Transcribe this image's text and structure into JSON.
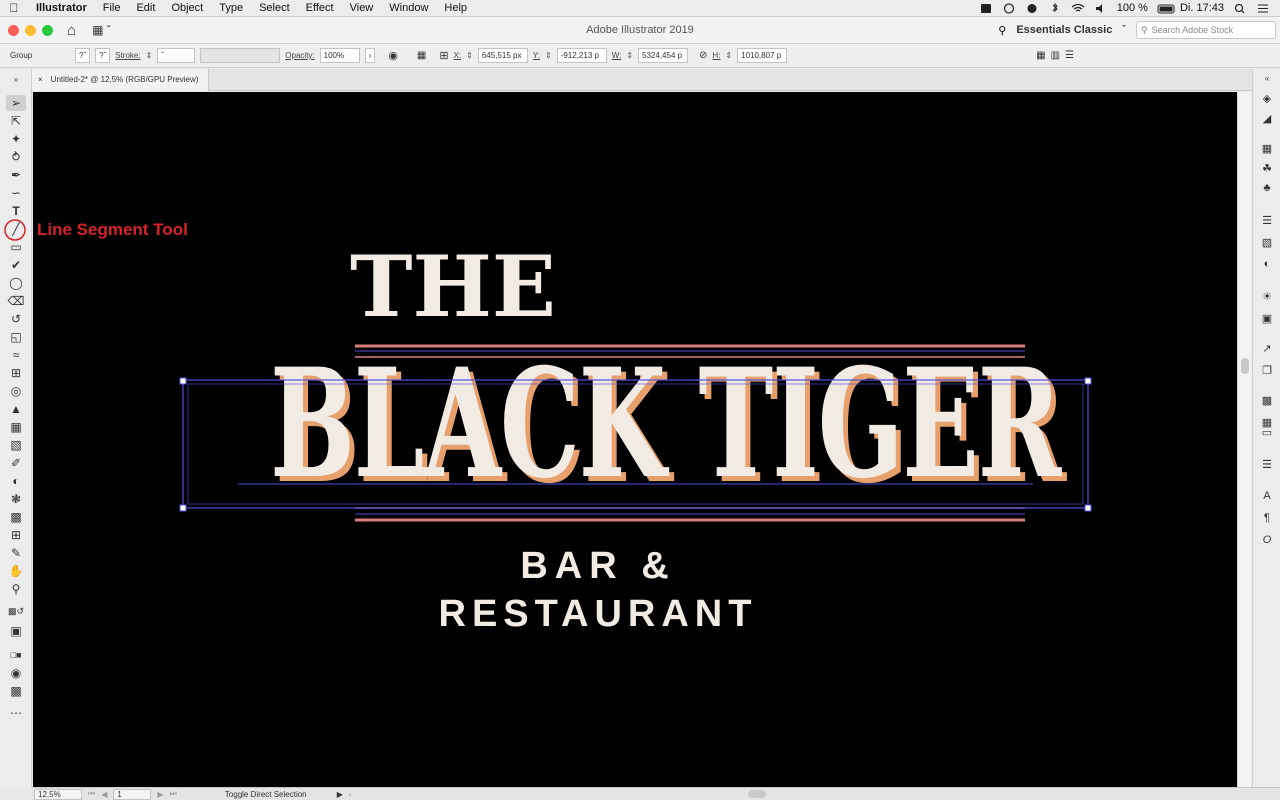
{
  "menubar": {
    "app_name": "Illustrator",
    "items": [
      "File",
      "Edit",
      "Object",
      "Type",
      "Select",
      "Effect",
      "View",
      "Window",
      "Help"
    ],
    "battery": "100 %",
    "clock": "Di. 17:43"
  },
  "titlebar": {
    "app_title": "Adobe Illustrator 2019",
    "workspace": "Essentials Classic",
    "search_placeholder": "Search Adobe Stock"
  },
  "controlbar": {
    "selection": "Group",
    "stroke_label": "Stroke:",
    "opacity_label": "Opacity:",
    "opacity_value": "100%",
    "x_label": "X:",
    "x_value": "645,515 px",
    "y_label": "Y:",
    "y_value": "-912,213 p",
    "w_label": "W:",
    "w_value": "5324,454 p",
    "h_label": "H:",
    "h_value": "1010,807 p"
  },
  "document": {
    "tab_title": "Untitled-2* @ 12,5% (RGB/GPU Preview)"
  },
  "artwork": {
    "line1": "THE",
    "line2": "BLACK TIGER",
    "line3": "BAR &",
    "line4": "RESTAURANT",
    "text_color": "#f1ebe4",
    "shadow_color": "#e7a06b",
    "rule_color": "#d9807c",
    "selection_color": "#4f4fe0"
  },
  "annotation": {
    "label": "Line Segment Tool",
    "color": "#d7222a"
  },
  "statusbar": {
    "zoom": "12,5%",
    "artboard": "1",
    "status_text": "Toggle Direct Selection"
  }
}
